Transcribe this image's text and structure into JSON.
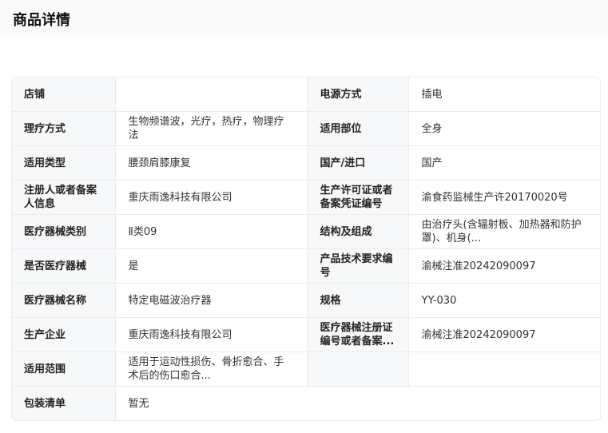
{
  "page": {
    "title": "商品详情"
  },
  "specs": {
    "r0": {
      "l1": "店铺",
      "v1": "",
      "l2": "电源方式",
      "v2": "插电"
    },
    "r1": {
      "l1": "理疗方式",
      "v1": "生物频谱波，光疗，热疗，物理疗法",
      "l2": "适用部位",
      "v2": "全身"
    },
    "r2": {
      "l1": "适用类型",
      "v1": "腰颈肩膝康复",
      "l2": "国产/进口",
      "v2": "国产"
    },
    "r3": {
      "l1": "注册人或者备案人信息",
      "v1": "重庆雨逸科技有限公司",
      "l2": "生产许可证或者备案凭证编号",
      "v2": "渝食药监械生产许20170020号"
    },
    "r4": {
      "l1": "医疗器械类别",
      "v1": "Ⅱ类09",
      "l2": "结构及组成",
      "v2": "由治疗头(含辐射板、加热器和防护罩)、机身(..."
    },
    "r5": {
      "l1": "是否医疗器械",
      "v1": "是",
      "l2": "产品技术要求编号",
      "v2": "渝械注准20242090097"
    },
    "r6": {
      "l1": "医疗器械名称",
      "v1": "特定电磁波治疗器",
      "l2": "规格",
      "v2": "YY-030"
    },
    "r7": {
      "l1": "生产企业",
      "v1": "重庆雨逸科技有限公司",
      "l2": "医疗器械注册证编号或者备案...",
      "v2": "渝械注准20242090097"
    },
    "r8": {
      "l1": "适用范围",
      "v1": "适用于运动性损伤、骨折愈合、手术后的伤口愈合..."
    },
    "r9": {
      "l1": "包装清单",
      "v1": "暂无"
    }
  }
}
